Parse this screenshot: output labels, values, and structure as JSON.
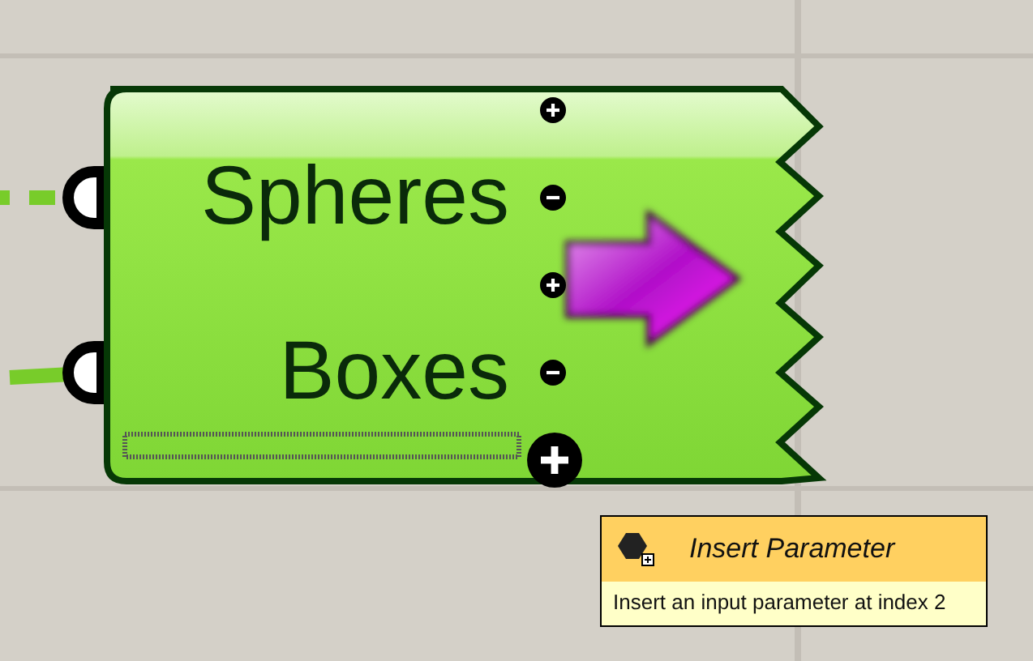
{
  "component": {
    "inputs": [
      {
        "label": "Spheres"
      },
      {
        "label": "Boxes"
      }
    ]
  },
  "tooltip": {
    "title": "Insert Parameter",
    "description": "Insert an input parameter at index 2"
  }
}
